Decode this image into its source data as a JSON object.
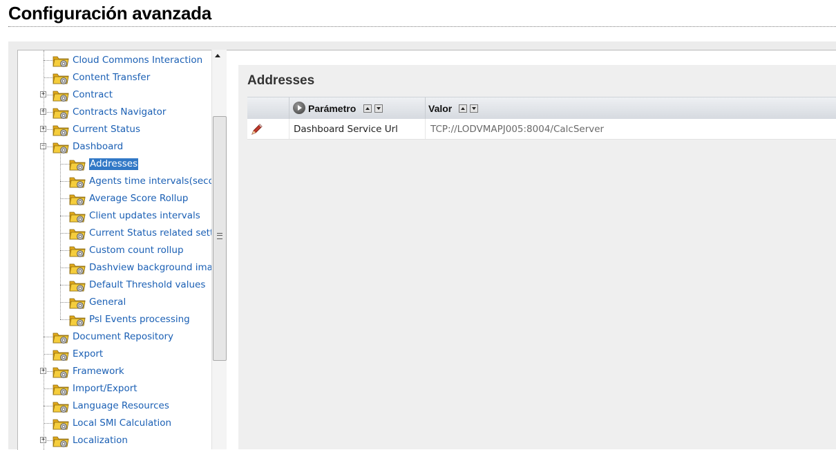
{
  "page": {
    "title": "Configuración avanzada"
  },
  "tree": {
    "items": [
      {
        "label": "Cloud Commons Interaction",
        "level": 0,
        "expander": "none",
        "selected": false
      },
      {
        "label": "Content Transfer",
        "level": 0,
        "expander": "none",
        "selected": false
      },
      {
        "label": "Contract",
        "level": 0,
        "expander": "plus",
        "selected": false
      },
      {
        "label": "Contracts Navigator",
        "level": 0,
        "expander": "plus",
        "selected": false
      },
      {
        "label": "Current Status",
        "level": 0,
        "expander": "plus",
        "selected": false
      },
      {
        "label": "Dashboard",
        "level": 0,
        "expander": "minus",
        "selected": false
      },
      {
        "label": "Addresses",
        "level": 1,
        "expander": "none",
        "selected": true
      },
      {
        "label": "Agents time intervals(seconds",
        "level": 1,
        "expander": "none",
        "selected": false
      },
      {
        "label": "Average Score Rollup",
        "level": 1,
        "expander": "none",
        "selected": false
      },
      {
        "label": "Client updates intervals",
        "level": 1,
        "expander": "none",
        "selected": false
      },
      {
        "label": "Current Status related setting",
        "level": 1,
        "expander": "none",
        "selected": false
      },
      {
        "label": "Custom count rollup",
        "level": 1,
        "expander": "none",
        "selected": false
      },
      {
        "label": "Dashview background image",
        "level": 1,
        "expander": "none",
        "selected": false
      },
      {
        "label": "Default Threshold values",
        "level": 1,
        "expander": "none",
        "selected": false
      },
      {
        "label": "General",
        "level": 1,
        "expander": "none",
        "selected": false
      },
      {
        "label": "Psl Events processing",
        "level": 1,
        "expander": "none",
        "selected": false
      },
      {
        "label": "Document Repository",
        "level": 0,
        "expander": "none",
        "selected": false
      },
      {
        "label": "Export",
        "level": 0,
        "expander": "none",
        "selected": false
      },
      {
        "label": "Framework",
        "level": 0,
        "expander": "plus",
        "selected": false
      },
      {
        "label": "Import/Export",
        "level": 0,
        "expander": "none",
        "selected": false
      },
      {
        "label": "Language Resources",
        "level": 0,
        "expander": "none",
        "selected": false
      },
      {
        "label": "Local SMI Calculation",
        "level": 0,
        "expander": "none",
        "selected": false
      },
      {
        "label": "Localization",
        "level": 0,
        "expander": "plus",
        "selected": false
      }
    ]
  },
  "section": {
    "title": "Addresses"
  },
  "grid": {
    "columns": {
      "param": "Parámetro",
      "value": "Valor"
    },
    "rows": [
      {
        "param": "Dashboard Service Url",
        "value": "TCP://LODVMAPJ005:8004/CalcServer"
      }
    ]
  },
  "colors": {
    "link": "#1a5fb4",
    "selected_bg": "#3178c6",
    "value_text": "#6a6a6a",
    "folder": "#f2c230"
  },
  "icons": {
    "folder": "folder-gear-icon",
    "edit": "pencil-icon",
    "column_menu": "play-circle-icon",
    "sort_asc": "sort-up-icon",
    "sort_desc": "sort-down-icon",
    "scroll_up": "scroll-up-arrow-icon"
  }
}
